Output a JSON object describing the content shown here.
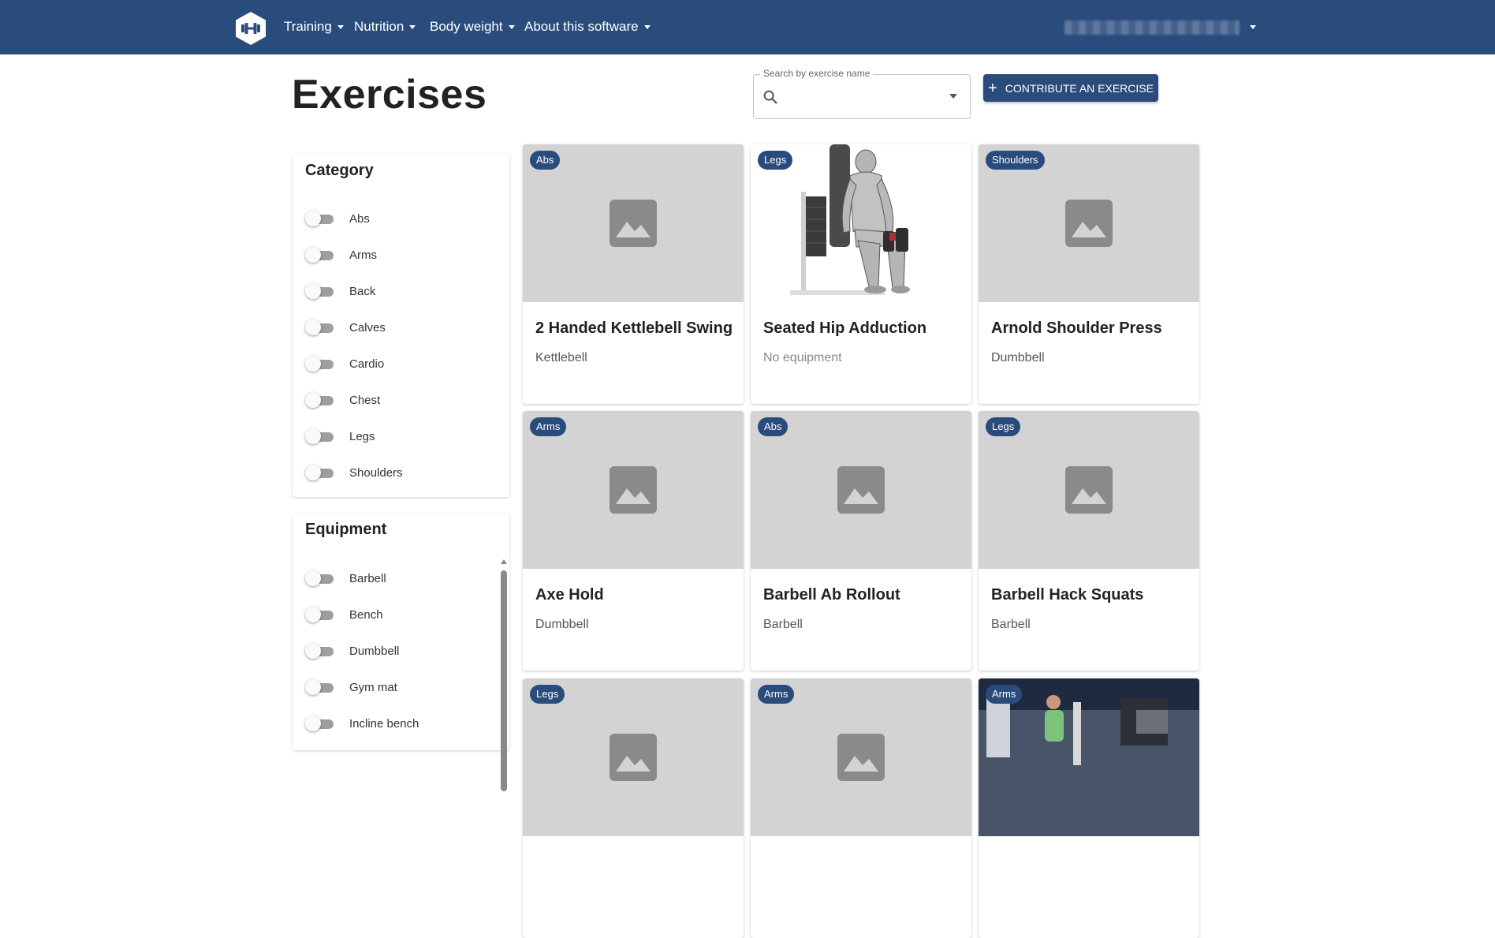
{
  "nav": {
    "items": [
      {
        "label": "Training"
      },
      {
        "label": "Nutrition"
      },
      {
        "label": "Body weight"
      },
      {
        "label": "About this software"
      }
    ]
  },
  "header": {
    "title": "Exercises",
    "search_label": "Search by exercise name",
    "contribute_label": "CONTRIBUTE AN EXERCISE"
  },
  "filters": {
    "category": {
      "title": "Category",
      "items": [
        "Abs",
        "Arms",
        "Back",
        "Calves",
        "Cardio",
        "Chest",
        "Legs",
        "Shoulders"
      ]
    },
    "equipment": {
      "title": "Equipment",
      "items": [
        "Barbell",
        "Bench",
        "Dumbbell",
        "Gym mat",
        "Incline bench"
      ]
    }
  },
  "exercises": [
    {
      "category": "Abs",
      "name": "2 Handed Kettlebell Swing",
      "equipment": "Kettlebell",
      "image": "placeholder"
    },
    {
      "category": "Legs",
      "name": "Seated Hip Adduction",
      "equipment": "No equipment",
      "image": "illustration"
    },
    {
      "category": "Shoulders",
      "name": "Arnold Shoulder Press",
      "equipment": "Dumbbell",
      "image": "placeholder"
    },
    {
      "category": "Arms",
      "name": "Axe Hold",
      "equipment": "Dumbbell",
      "image": "placeholder"
    },
    {
      "category": "Abs",
      "name": "Barbell Ab Rollout",
      "equipment": "Barbell",
      "image": "placeholder"
    },
    {
      "category": "Legs",
      "name": "Barbell Hack Squats",
      "equipment": "Barbell",
      "image": "placeholder"
    },
    {
      "category": "Legs",
      "name": "",
      "equipment": "",
      "image": "placeholder"
    },
    {
      "category": "Arms",
      "name": "",
      "equipment": "",
      "image": "placeholder"
    },
    {
      "category": "Arms",
      "name": "",
      "equipment": "",
      "image": "photo"
    }
  ],
  "colors": {
    "primary": "#2a4c7d",
    "placeholder_bg": "#d3d3d3",
    "placeholder_icon": "#8a8a8a"
  }
}
